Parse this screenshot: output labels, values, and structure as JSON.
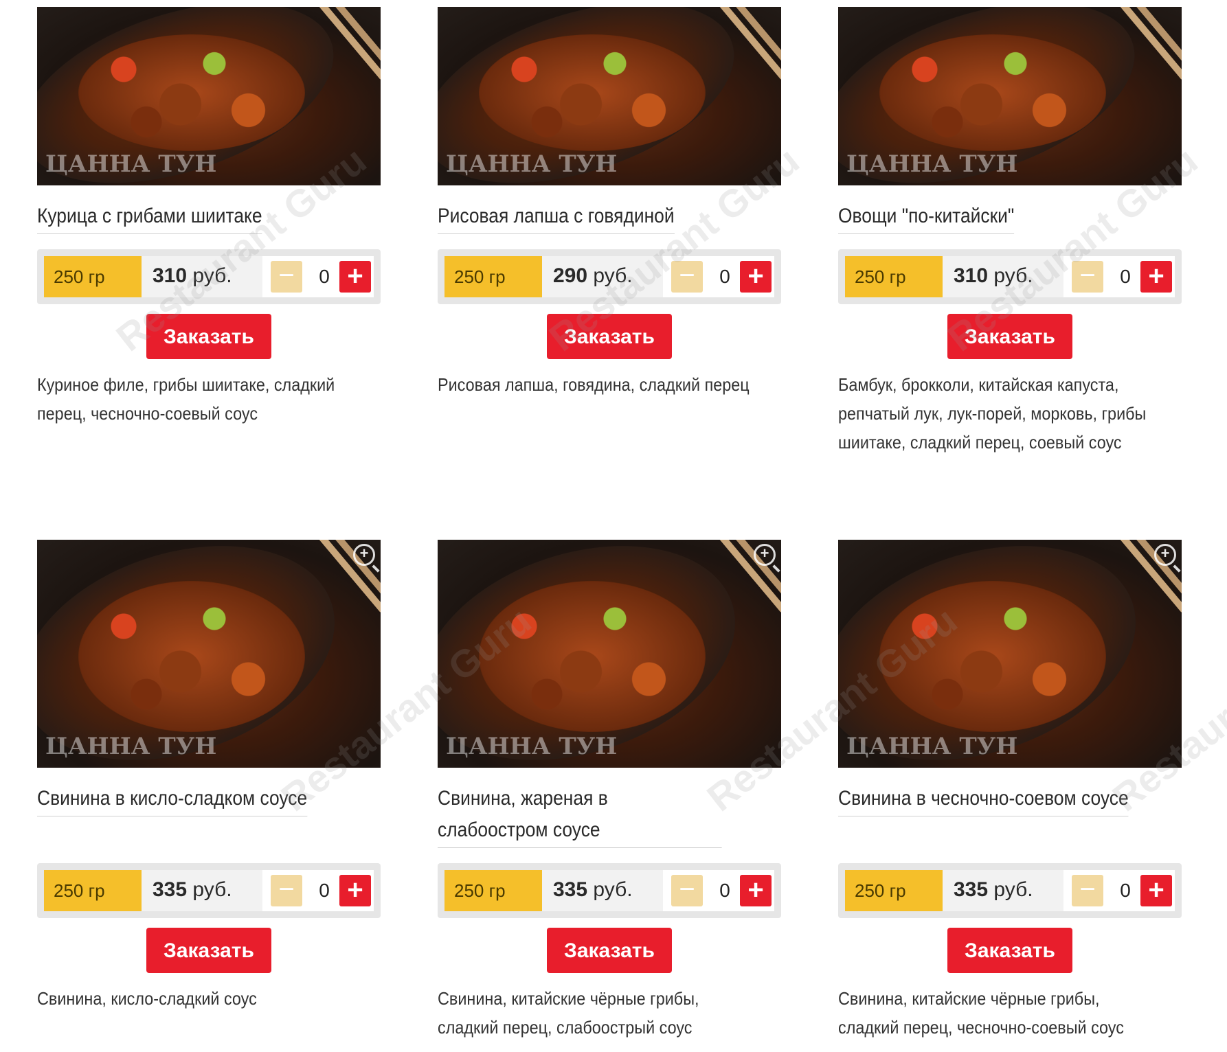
{
  "menu": {
    "items": [
      {
        "name": "Курица с грибами шиитаке",
        "weight": "250 гр",
        "price_value": "310",
        "price_unit": "руб.",
        "quantity": "0",
        "minus": "−",
        "plus": "+",
        "order_label": "Заказать",
        "description": "Куриное филе, грибы шиитаке, сладкий перец, чесночно-соевый соус"
      },
      {
        "name": "Рисовая лапша с говядиной",
        "weight": "250 гр",
        "price_value": "290",
        "price_unit": "руб.",
        "quantity": "0",
        "minus": "−",
        "plus": "+",
        "order_label": "Заказать",
        "description": "Рисовая лапша, говядина, сладкий перец"
      },
      {
        "name": "Овощи \"по-китайски\"",
        "weight": "250 гр",
        "price_value": "310",
        "price_unit": "руб.",
        "quantity": "0",
        "minus": "−",
        "plus": "+",
        "order_label": "Заказать",
        "description": "Бамбук, брокколи, китайская капуста, репчатый лук, лук-порей, морковь, грибы шиитаке, сладкий перец, соевый соус"
      },
      {
        "name": "Свинина в кисло-сладком соусе",
        "weight": "250 гр",
        "price_value": "335",
        "price_unit": "руб.",
        "quantity": "0",
        "minus": "−",
        "plus": "+",
        "order_label": "Заказать",
        "description": "Свинина, кисло-сладкий соус"
      },
      {
        "name": "Свинина, жареная в слабоостром соусе",
        "weight": "250 гр",
        "price_value": "335",
        "price_unit": "руб.",
        "quantity": "0",
        "minus": "−",
        "plus": "+",
        "order_label": "Заказать",
        "description": "Свинина, китайские чёрные грибы, сладкий перец, слабоострый соус"
      },
      {
        "name": "Свинина в чесночно-соевом соусе",
        "weight": "250 гр",
        "price_value": "335",
        "price_unit": "руб.",
        "quantity": "0",
        "minus": "−",
        "plus": "+",
        "order_label": "Заказать",
        "description": "Свинина, китайские чёрные грибы, сладкий перец, чесночно-соевый соус"
      }
    ],
    "photo_brand": "ЦАННА ТУН",
    "watermark": "Restaurant Guru"
  },
  "colors": {
    "weight_badge": "#f5bf2a",
    "accent_red": "#e81e2c",
    "minus_disabled": "#f2d9a0",
    "panel_bg": "#e6e6e6"
  },
  "icons": {
    "zoom": "zoom-in-icon",
    "minus": "minus-icon",
    "plus": "plus-icon"
  }
}
